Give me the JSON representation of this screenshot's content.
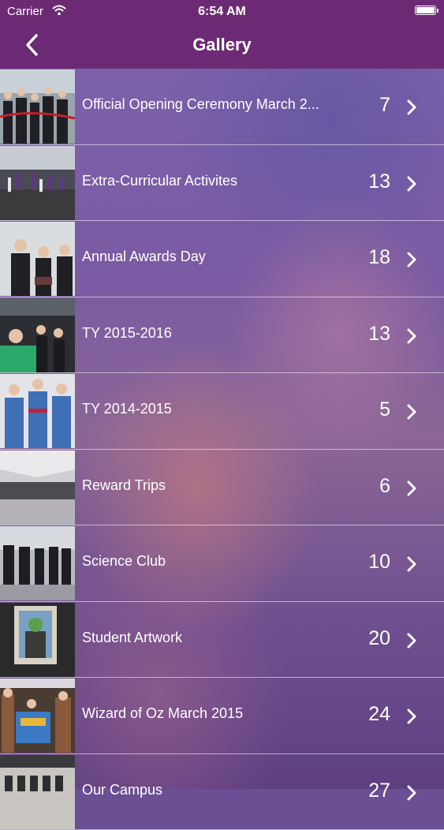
{
  "status_bar": {
    "carrier": "Carrier",
    "time": "6:54 AM"
  },
  "nav": {
    "title": "Gallery"
  },
  "albums": [
    {
      "title": "Official Opening Ceremony March 2...",
      "count": "7"
    },
    {
      "title": "Extra-Curricular Activites",
      "count": "13"
    },
    {
      "title": "Annual Awards Day",
      "count": "18"
    },
    {
      "title": "TY 2015-2016",
      "count": "13"
    },
    {
      "title": "TY 2014-2015",
      "count": "5"
    },
    {
      "title": "Reward Trips",
      "count": "6"
    },
    {
      "title": "Science Club",
      "count": "10"
    },
    {
      "title": "Student Artwork",
      "count": "20"
    },
    {
      "title": "Wizard of Oz March 2015",
      "count": "24"
    },
    {
      "title": "Our Campus",
      "count": "27"
    }
  ],
  "colors": {
    "header": "#6c2a74",
    "background": "#7a5aa3"
  }
}
